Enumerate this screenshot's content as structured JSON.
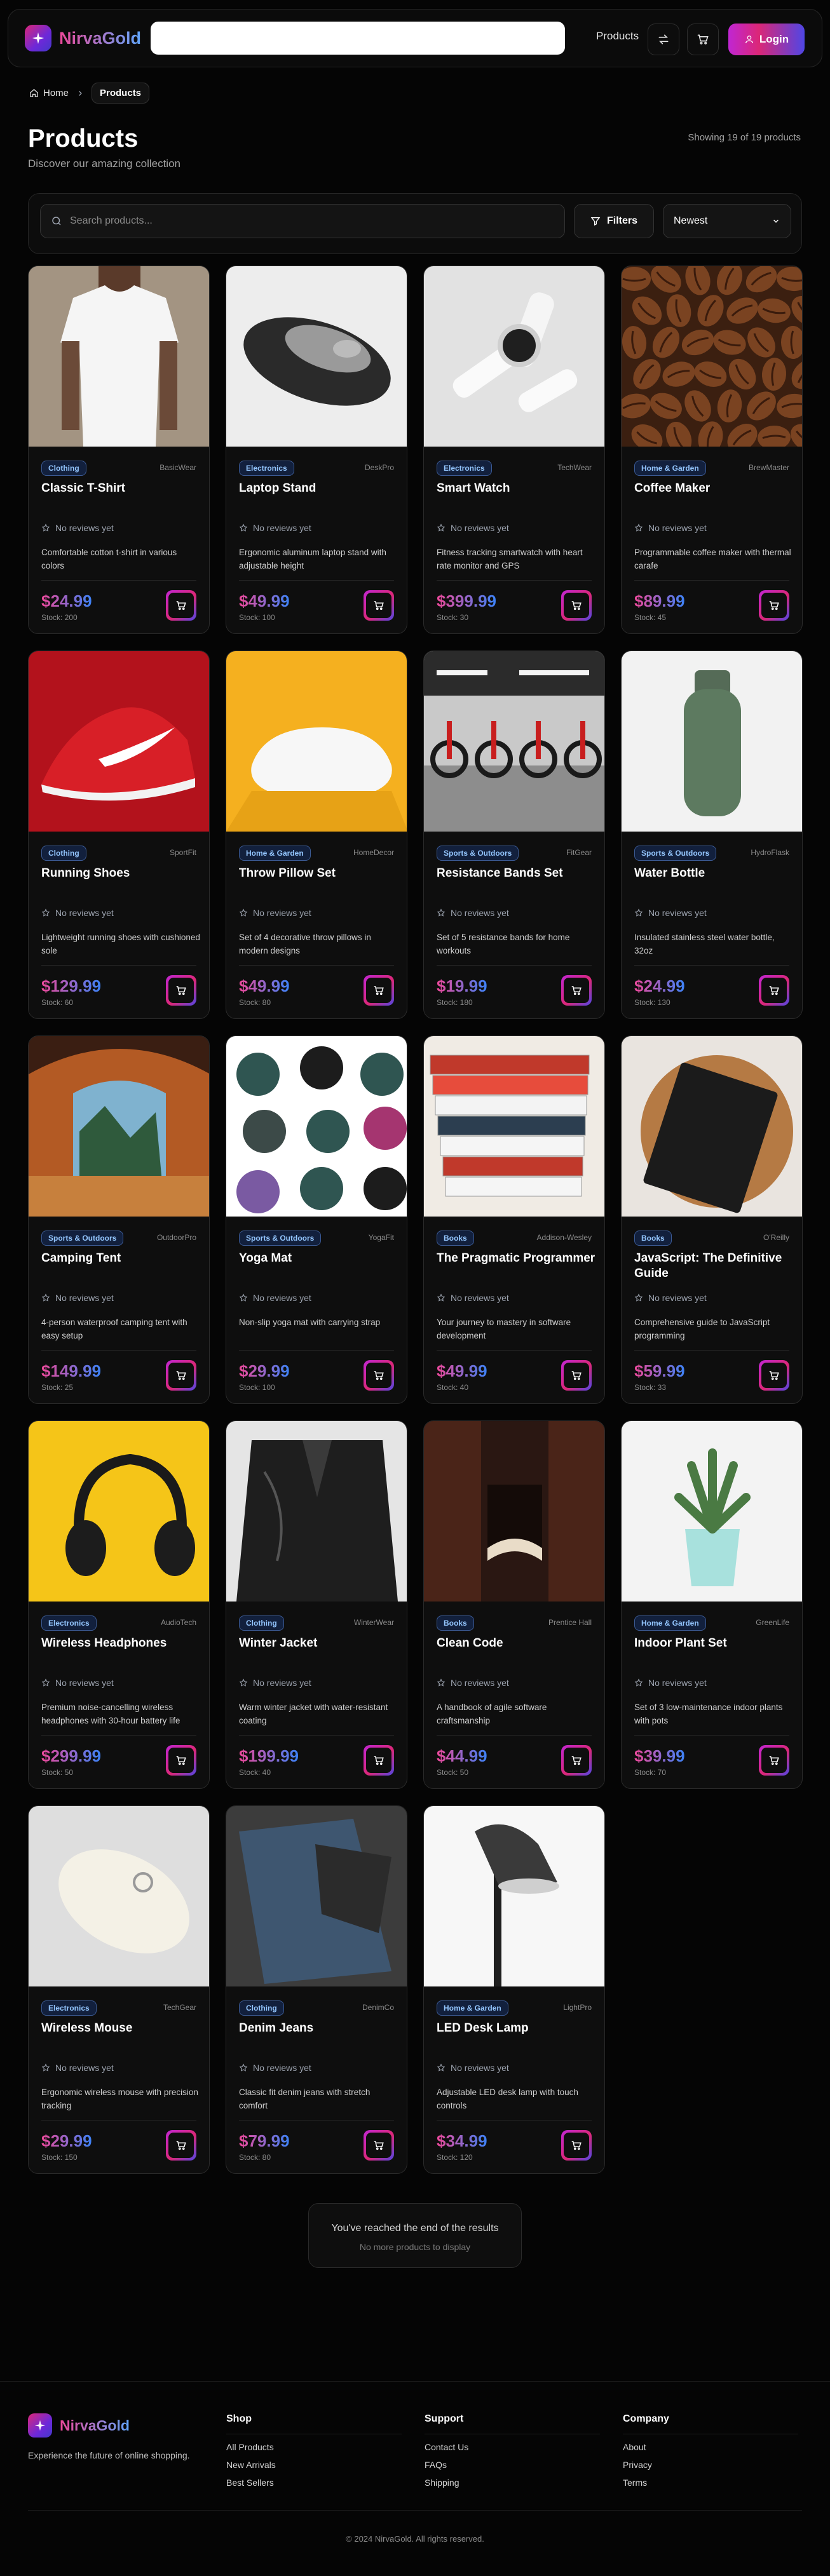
{
  "header": {
    "logo_text": "NirvaGold",
    "nav_products": "Products",
    "login_label": "Login",
    "compare_icon": "arrows-exchange-icon",
    "cart_icon": "shopping-cart-icon"
  },
  "breadcrumb": {
    "home": "Home",
    "current": "Products"
  },
  "page": {
    "title": "Products",
    "subtitle": "Discover our amazing collection",
    "showing": "Showing 19 of 19 products"
  },
  "filters": {
    "search_placeholder": "Search products...",
    "filters_label": "Filters",
    "sort_value": "Newest"
  },
  "reviews_label": "No reviews yet",
  "products": [
    {
      "category": "Clothing",
      "brand": "BasicWear",
      "name": "Classic T-Shirt",
      "desc": "Comfortable cotton t-shirt in various colors",
      "price": "$24.99",
      "stock": "Stock: 200",
      "image": "tshirt"
    },
    {
      "category": "Electronics",
      "brand": "DeskPro",
      "name": "Laptop Stand",
      "desc": "Ergonomic aluminum laptop stand with adjustable height",
      "price": "$49.99",
      "stock": "Stock: 100",
      "image": "mouse-gray"
    },
    {
      "category": "Electronics",
      "brand": "TechWear",
      "name": "Smart Watch",
      "desc": "Fitness tracking smartwatch with heart rate monitor and GPS",
      "price": "$399.99",
      "stock": "Stock: 30",
      "image": "watch"
    },
    {
      "category": "Home & Garden",
      "brand": "BrewMaster",
      "name": "Coffee Maker",
      "desc": "Programmable coffee maker with thermal carafe",
      "price": "$89.99",
      "stock": "Stock: 45",
      "image": "coffee"
    },
    {
      "category": "Clothing",
      "brand": "SportFit",
      "name": "Running Shoes",
      "desc": "Lightweight running shoes with cushioned sole",
      "price": "$129.99",
      "stock": "Stock: 60",
      "image": "shoe"
    },
    {
      "category": "Home & Garden",
      "brand": "HomeDecor",
      "name": "Throw Pillow Set",
      "desc": "Set of 4 decorative throw pillows in modern designs",
      "price": "$49.99",
      "stock": "Stock: 80",
      "image": "pillow"
    },
    {
      "category": "Sports & Outdoors",
      "brand": "FitGear",
      "name": "Resistance Bands Set",
      "desc": "Set of 5 resistance bands for home workouts",
      "price": "$19.99",
      "stock": "Stock: 180",
      "image": "gym"
    },
    {
      "category": "Sports & Outdoors",
      "brand": "HydroFlask",
      "name": "Water Bottle",
      "desc": "Insulated stainless steel water bottle, 32oz",
      "price": "$24.99",
      "stock": "Stock: 130",
      "image": "bottle"
    },
    {
      "category": "Sports & Outdoors",
      "brand": "OutdoorPro",
      "name": "Camping Tent",
      "desc": "4-person waterproof camping tent with easy setup",
      "price": "$149.99",
      "stock": "Stock: 25",
      "image": "tent"
    },
    {
      "category": "Sports & Outdoors",
      "brand": "YogaFit",
      "name": "Yoga Mat",
      "desc": "Non-slip yoga mat with carrying strap",
      "price": "$29.99",
      "stock": "Stock: 100",
      "image": "mats"
    },
    {
      "category": "Books",
      "brand": "Addison-Wesley",
      "name": "The Pragmatic Programmer",
      "desc": "Your journey to mastery in software development",
      "price": "$49.99",
      "stock": "Stock: 40",
      "image": "books"
    },
    {
      "category": "Books",
      "brand": "O'Reilly",
      "name": "JavaScript: The Definitive Guide",
      "desc": "Comprehensive guide to JavaScript programming",
      "price": "$59.99",
      "stock": "Stock: 33",
      "image": "honeybook"
    },
    {
      "category": "Electronics",
      "brand": "AudioTech",
      "name": "Wireless Headphones",
      "desc": "Premium noise-cancelling wireless headphones with 30-hour battery life",
      "price": "$299.99",
      "stock": "Stock: 50",
      "image": "headphones"
    },
    {
      "category": "Clothing",
      "brand": "WinterWear",
      "name": "Winter Jacket",
      "desc": "Warm winter jacket with water-resistant coating",
      "price": "$199.99",
      "stock": "Stock: 40",
      "image": "jacket"
    },
    {
      "category": "Books",
      "brand": "Prentice Hall",
      "name": "Clean Code",
      "desc": "A handbook of agile software craftsmanship",
      "price": "$44.99",
      "stock": "Stock: 50",
      "image": "library"
    },
    {
      "category": "Home & Garden",
      "brand": "GreenLife",
      "name": "Indoor Plant Set",
      "desc": "Set of 3 low-maintenance indoor plants with pots",
      "price": "$39.99",
      "stock": "Stock: 70",
      "image": "plant"
    },
    {
      "category": "Electronics",
      "brand": "TechGear",
      "name": "Wireless Mouse",
      "desc": "Ergonomic wireless mouse with precision tracking",
      "price": "$29.99",
      "stock": "Stock: 150",
      "image": "mouse-white"
    },
    {
      "category": "Clothing",
      "brand": "DenimCo",
      "name": "Denim Jeans",
      "desc": "Classic fit denim jeans with stretch comfort",
      "price": "$79.99",
      "stock": "Stock: 80",
      "image": "jeans"
    },
    {
      "category": "Home & Garden",
      "brand": "LightPro",
      "name": "LED Desk Lamp",
      "desc": "Adjustable LED desk lamp with touch controls",
      "price": "$34.99",
      "stock": "Stock: 120",
      "image": "lamp"
    }
  ],
  "end_of_results": {
    "title": "You've reached the end of the results",
    "subtitle": "No more products to display"
  },
  "footer": {
    "logo_text": "NirvaGold",
    "tagline": "Experience the future of online shopping.",
    "shop": {
      "title": "Shop",
      "links": [
        "All Products",
        "New Arrivals",
        "Best Sellers"
      ]
    },
    "support": {
      "title": "Support",
      "links": [
        "Contact Us",
        "FAQs",
        "Shipping"
      ]
    },
    "company": {
      "title": "Company",
      "links": [
        "About",
        "Privacy",
        "Terms"
      ]
    },
    "copyright": "© 2024 NirvaGold. All rights reserved."
  }
}
